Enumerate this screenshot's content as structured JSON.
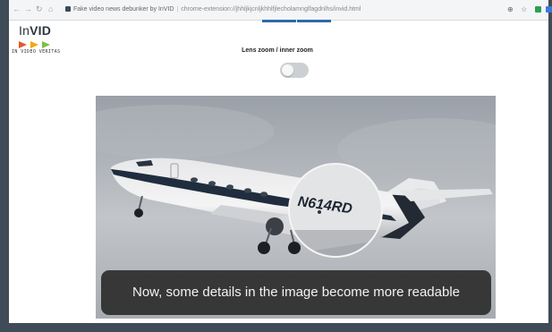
{
  "browser": {
    "tab_title": "Fake video news debunker by InVID",
    "url": "chrome-extension://jhhljkjcnljkhhlfjlecholamnglfagdnlhs/invid.html",
    "url_host": "chrome-extension",
    "url_path": "//jhhljkjcnljkhhlfjlecholamnglfagdnlhs/invid.html"
  },
  "logo": {
    "text_in": "In",
    "text_vid": "VID",
    "tagline": "IN VIDEO VERITAS",
    "colors": [
      "#e4572e",
      "#f2a900",
      "#7bc043"
    ]
  },
  "zoom": {
    "label": "Lens zoom / inner zoom",
    "toggle_on": false
  },
  "image": {
    "registration": "N614RD",
    "caption": "Now, some details in the image become more readable"
  },
  "colors": {
    "accent": "#2f6aa9",
    "frame": "#3f4b57"
  }
}
